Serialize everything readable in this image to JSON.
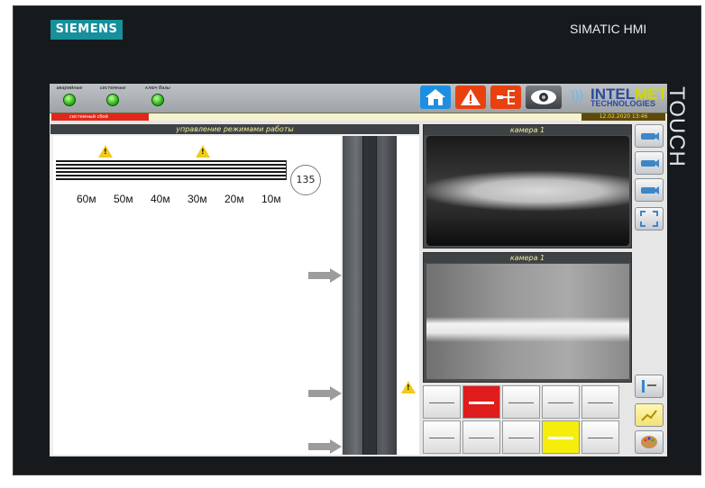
{
  "header": {
    "brand": "SIEMENS",
    "device_title": "SIMATIC HMI",
    "touch_label": "TOUCH"
  },
  "status_indicators": [
    {
      "label": "аварийные",
      "state_color": "#2fb418"
    },
    {
      "label": "системные",
      "state_color": "#2fb418"
    },
    {
      "label": "ключ базы",
      "state_color": "#2fb418"
    }
  ],
  "nav": {
    "home_icon": "home-icon",
    "alarm_icon": "alarm-triangle-icon",
    "network_icon": "network-icon",
    "camera_icon": "camera-view-icon"
  },
  "logo": {
    "intel": "INTEL",
    "met": "MET",
    "tech": "TECHNOLOGIES"
  },
  "alarm_bar": {
    "message": "системный сбой",
    "datetime": "12.02.2020 13:46"
  },
  "left_panel": {
    "title": "управление режимами работы",
    "counter": "135",
    "distances": [
      "60м",
      "50м",
      "40м",
      "30м",
      "20м",
      "10м"
    ]
  },
  "cameras": [
    {
      "title": "камера 1"
    },
    {
      "title": "камера 1"
    }
  ],
  "defect_grid": {
    "cells": [
      "normal",
      "red",
      "normal",
      "normal",
      "normal",
      "normal",
      "normal",
      "normal",
      "yellow",
      "normal"
    ]
  },
  "colors": {
    "alarm_red": "#e01c1c",
    "warning_yellow": "#f5ee0a",
    "accent_teal": "#16909c"
  }
}
